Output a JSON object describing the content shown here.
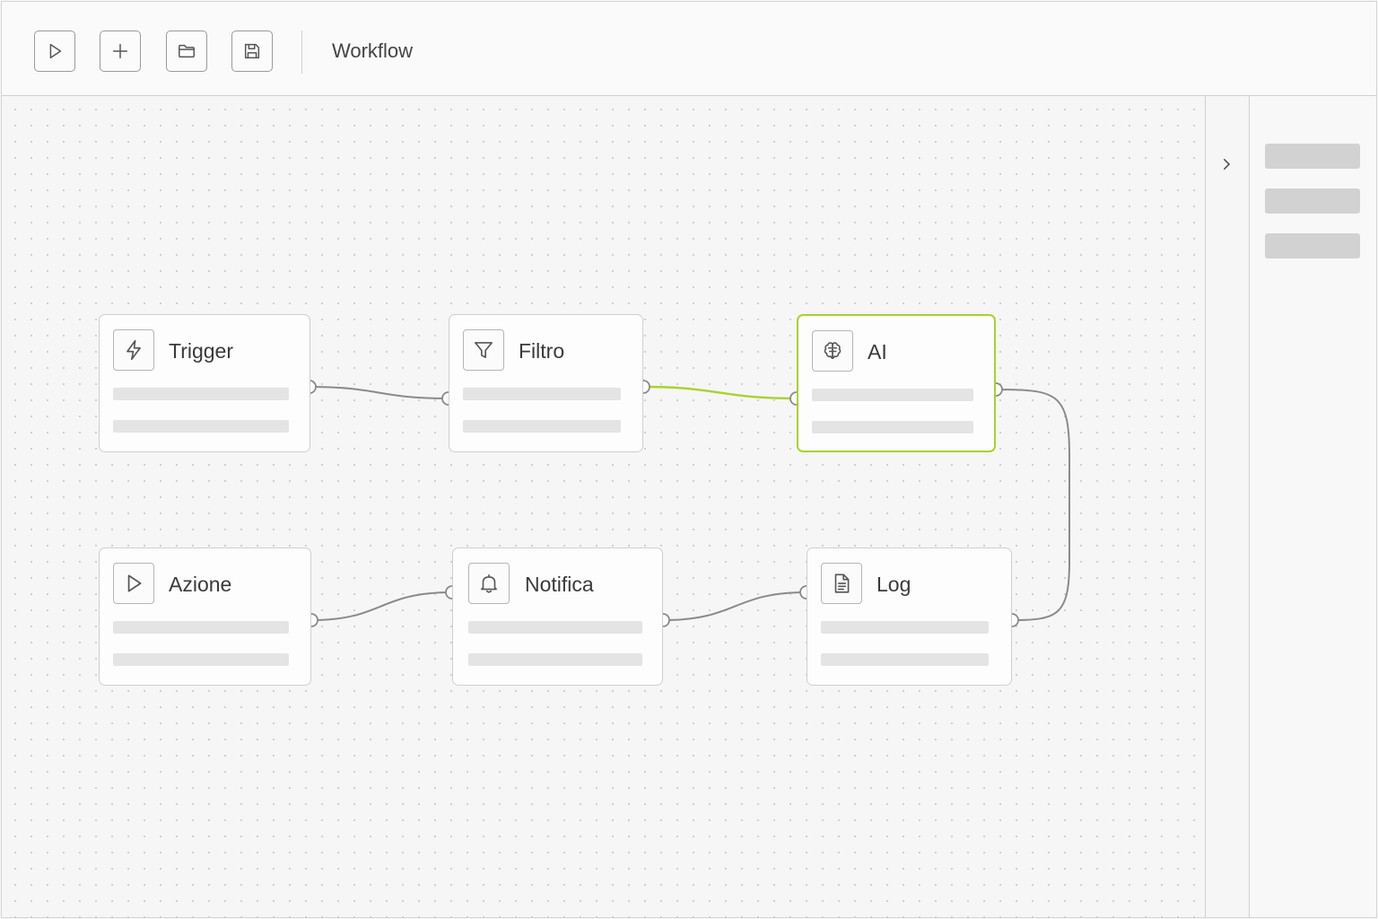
{
  "toolbar": {
    "title": "Workflow",
    "buttons": [
      {
        "name": "run-button",
        "icon": "play-icon"
      },
      {
        "name": "add-node-button",
        "icon": "plus-icon"
      },
      {
        "name": "open-button",
        "icon": "folder-icon"
      },
      {
        "name": "save-button",
        "icon": "save-icon"
      }
    ]
  },
  "nodes": [
    {
      "id": "trigger",
      "label": "Trigger",
      "icon": "lightning-icon"
    },
    {
      "id": "filtro",
      "label": "Filtro",
      "icon": "filter-icon"
    },
    {
      "id": "ai",
      "label": "AI",
      "icon": "brain-icon",
      "selected": true
    },
    {
      "id": "azione",
      "label": "Azione",
      "icon": "play-icon"
    },
    {
      "id": "notifica",
      "label": "Notifica",
      "icon": "bell-icon"
    },
    {
      "id": "log",
      "label": "Log",
      "icon": "document-icon"
    }
  ],
  "edges": [
    {
      "from": "trigger",
      "to": "filtro"
    },
    {
      "from": "filtro",
      "to": "ai",
      "active": true
    },
    {
      "from": "ai",
      "to": "log"
    },
    {
      "from": "azione",
      "to": "notifica"
    },
    {
      "from": "notifica",
      "to": "log"
    }
  ],
  "side_panel": {
    "toggle_icon": "chevron-right-icon"
  },
  "colors": {
    "accent": "#a7d42a",
    "edge": "#8a8a8a",
    "border": "#cfcfcf"
  }
}
